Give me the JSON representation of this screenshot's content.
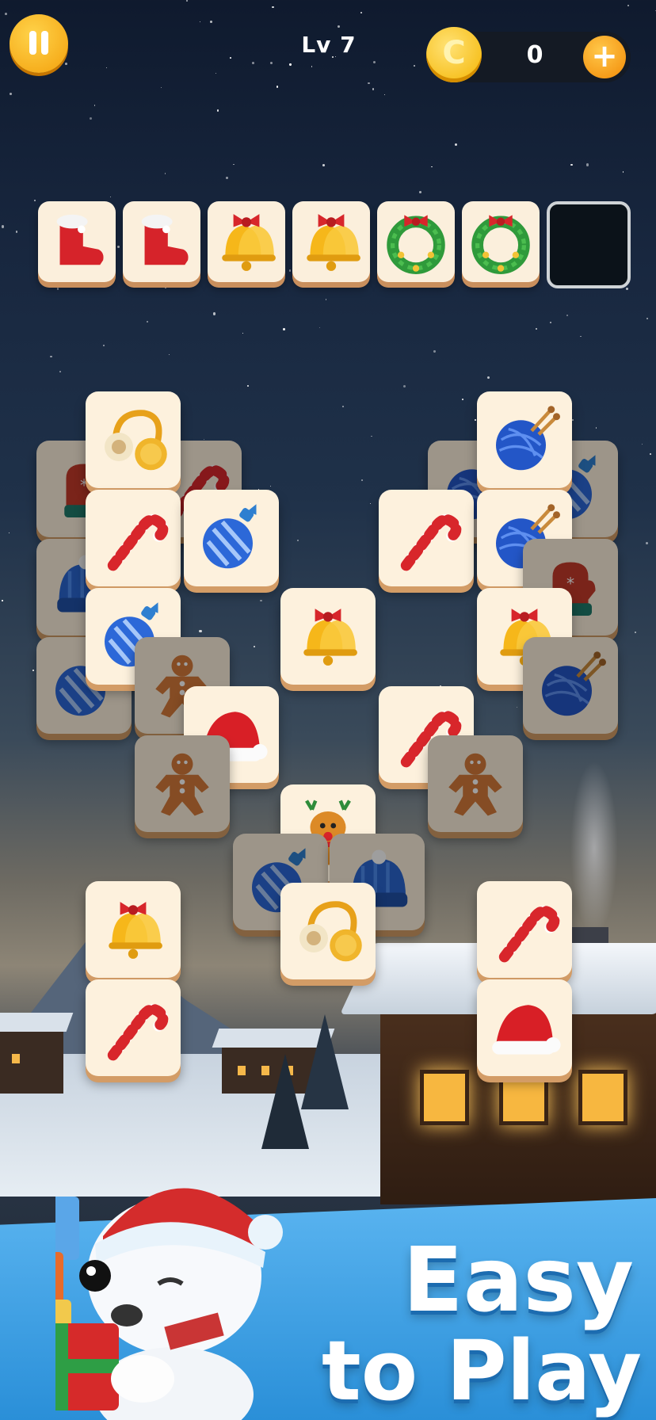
{
  "hud": {
    "pause_icon": "pause-icon",
    "level": "Lv 7",
    "coin_icon_letter": "C",
    "coins": "0",
    "add_coins": "+"
  },
  "tray": {
    "slots": [
      "boot-icon",
      "boot-icon",
      "bell-icon",
      "bell-icon",
      "wreath-icon",
      "wreath-icon",
      "empty"
    ]
  },
  "board": {
    "tiles": [
      {
        "icon": "mitten-icon",
        "dim": true
      },
      {
        "icon": "candy-cane-icon",
        "dim": true
      },
      {
        "icon": "earmuffs-icon",
        "dim": false
      },
      {
        "icon": "yarn-icon",
        "dim": true
      },
      {
        "icon": "ornament-icon",
        "dim": true
      },
      {
        "icon": "yarn-icon",
        "dim": false
      },
      {
        "icon": "beanie-icon",
        "dim": true
      },
      {
        "icon": "candy-cane-icon",
        "dim": false
      },
      {
        "icon": "ornament-icon",
        "dim": false
      },
      {
        "icon": "candy-cane-icon",
        "dim": false
      },
      {
        "icon": "yarn-icon",
        "dim": false
      },
      {
        "icon": "mitten-icon",
        "dim": true
      },
      {
        "icon": "ornament-icon",
        "dim": true
      },
      {
        "icon": "ornament-icon",
        "dim": false
      },
      {
        "icon": "bell-icon",
        "dim": false
      },
      {
        "icon": "bell-icon",
        "dim": false
      },
      {
        "icon": "yarn-icon",
        "dim": true
      },
      {
        "icon": "gingerbread-icon",
        "dim": true
      },
      {
        "icon": "santa-hat-icon",
        "dim": false
      },
      {
        "icon": "candy-cane-icon",
        "dim": false
      },
      {
        "icon": "gingerbread-icon",
        "dim": true
      },
      {
        "icon": "gingerbread-icon",
        "dim": true
      },
      {
        "icon": "reindeer-icon",
        "dim": false
      },
      {
        "icon": "ornament-icon",
        "dim": true
      },
      {
        "icon": "beanie-icon",
        "dim": true
      },
      {
        "icon": "earmuffs-icon",
        "dim": false
      },
      {
        "icon": "bell-icon",
        "dim": false
      },
      {
        "icon": "candy-cane-icon",
        "dim": false
      },
      {
        "icon": "candy-cane-icon",
        "dim": false
      },
      {
        "icon": "santa-hat-icon",
        "dim": false
      }
    ]
  },
  "banner": {
    "line1": "Easy",
    "line2": "to Play"
  },
  "colors": {
    "tile_face": "#fdf1dd",
    "tile_edge": "#d39c66",
    "gold": "#f4b400",
    "banner_blue": "#3a9de0"
  }
}
